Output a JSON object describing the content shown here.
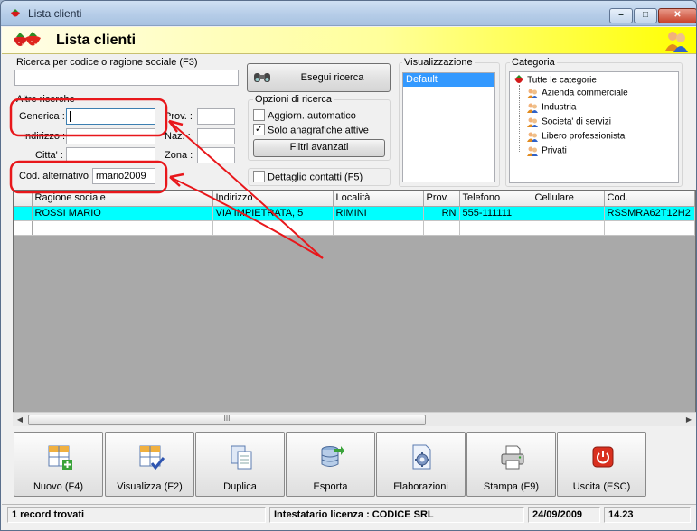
{
  "window": {
    "title": "Lista clienti",
    "buttons": {
      "minimize": "–",
      "maximize": "□",
      "close": "✕"
    }
  },
  "header": {
    "title": "Lista clienti"
  },
  "search": {
    "main_label": "Ricerca per codice o ragione sociale (F3)",
    "main_value": "",
    "run_button": "Esegui ricerca",
    "other_label": "Altre ricerche",
    "fields": {
      "generica_label": "Generica :",
      "generica_value": "",
      "indirizzo_label": "Indirizzo :",
      "indirizzo_value": "",
      "citta_label": "Citta' :",
      "citta_value": "",
      "prov_label": "Prov. :",
      "prov_value": "",
      "naz_label": "Naz. :",
      "naz_value": "",
      "zona_label": "Zona :",
      "zona_value": "",
      "codalt_label": "Cod. alternativo :",
      "codalt_value": "rmario2009"
    }
  },
  "options": {
    "legend": "Opzioni di ricerca",
    "auto_update": {
      "label": "Aggiorn. automatico",
      "checked": false
    },
    "only_active": {
      "label": "Solo anagrafiche attive",
      "checked": true
    },
    "advanced_filters": "Filtri avanzati",
    "contact_detail": {
      "label": "Dettaglio contatti (F5)",
      "checked": false
    }
  },
  "view": {
    "legend": "Visualizzazione",
    "items": [
      "Default"
    ]
  },
  "category": {
    "legend": "Categoria",
    "root": "Tutte le categorie",
    "items": [
      "Azienda commerciale",
      "Industria",
      "Societa' di servizi",
      "Libero professionista",
      "Privati"
    ]
  },
  "table": {
    "columns": [
      "Ragione sociale",
      "Indirizzo",
      "Località",
      "Prov.",
      "Telefono",
      "Cellulare",
      "Cod."
    ],
    "rows": [
      [
        "ROSSI MARIO",
        "VIA IMPIETRATA, 5",
        "RIMINI",
        "RN",
        "555-111111",
        "",
        "RSSMRA62T12H2"
      ]
    ],
    "scroll_thumb": "III"
  },
  "toolbar": {
    "new": "Nuovo (F4)",
    "view": "Visualizza (F2)",
    "duplicate": "Duplica",
    "export": "Esporta",
    "process": "Elaborazioni",
    "print": "Stampa (F9)",
    "exit": "Uscita (ESC)"
  },
  "status": {
    "records": "1 record trovati",
    "license": "Intestatario licenza : CODICE SRL",
    "date": "24/09/2009",
    "time": "14.23"
  },
  "colors": {
    "header_yellow": "#ffff00",
    "selection": "#00ffff",
    "annotation": "#e8171b"
  }
}
